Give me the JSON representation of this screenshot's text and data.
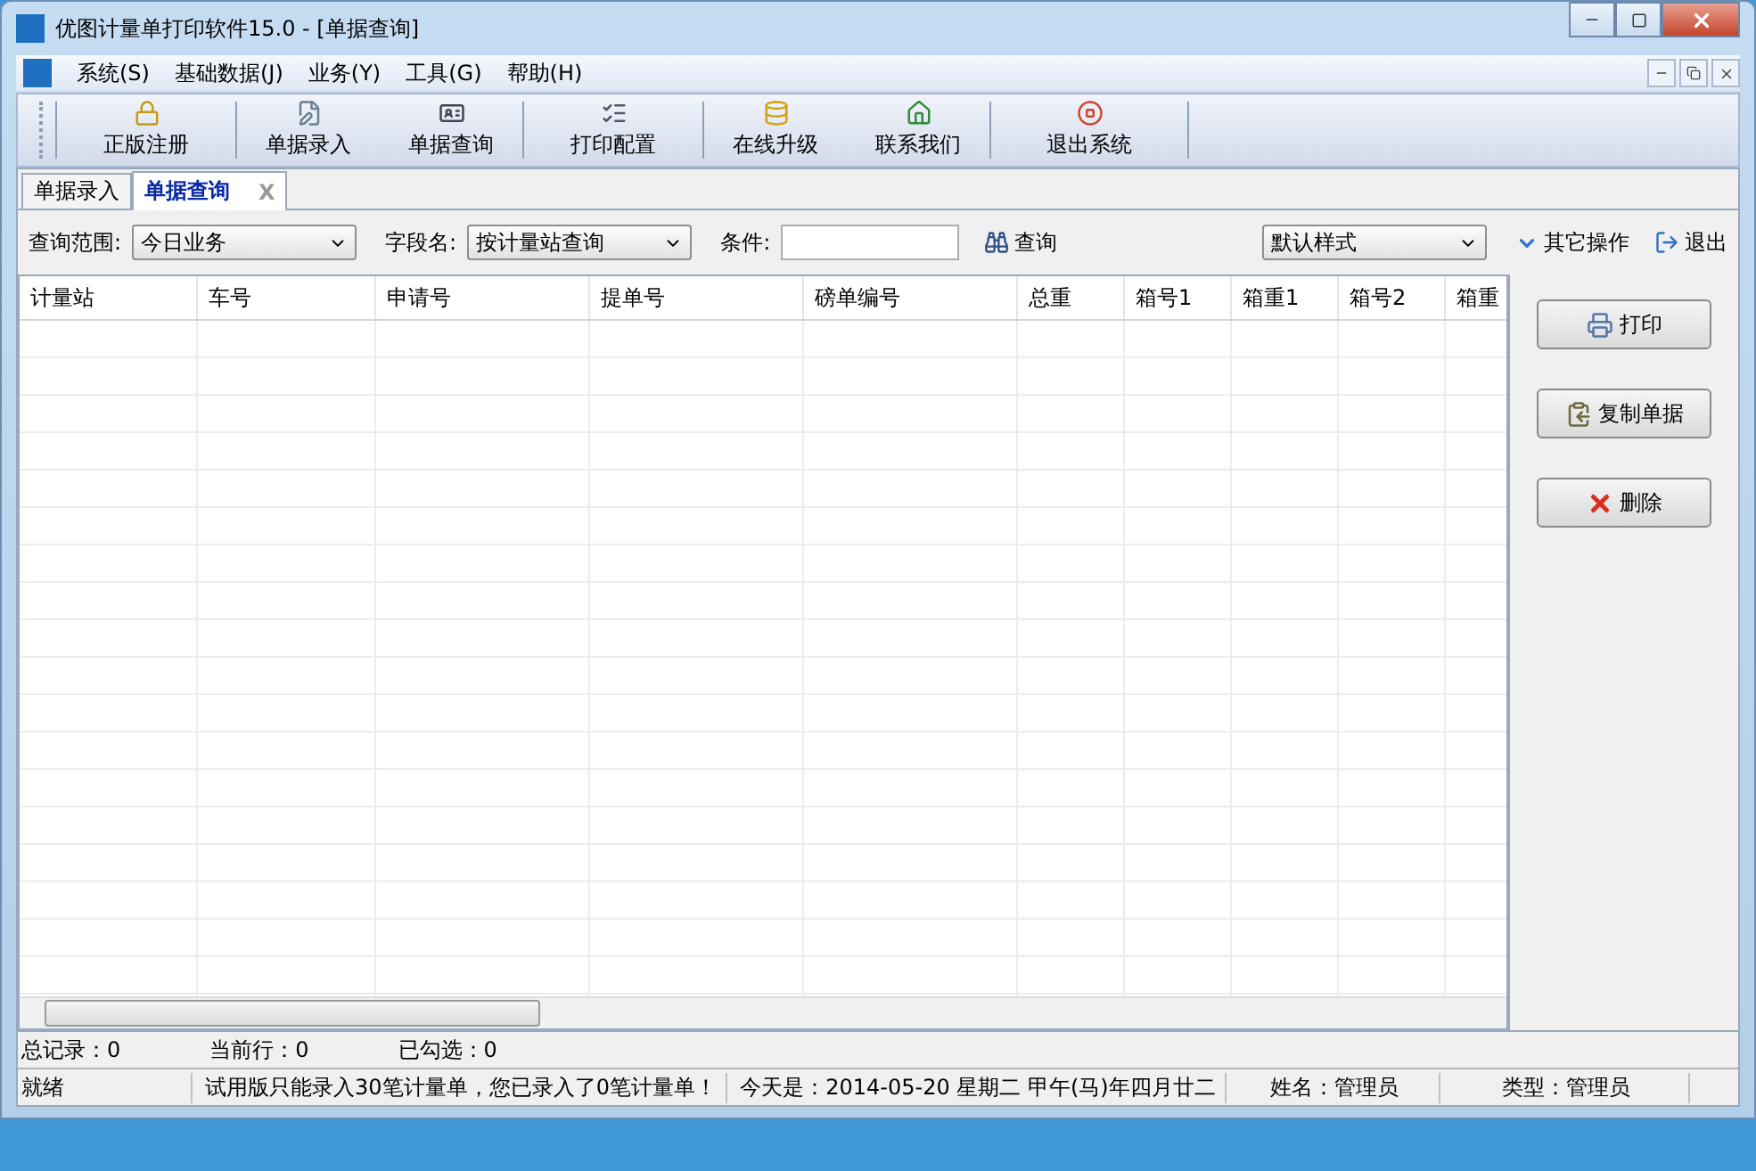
{
  "window": {
    "title": "优图计量单打印软件15.0 - [单据查询]"
  },
  "menu": [
    "系统(S)",
    "基础数据(J)",
    "业务(Y)",
    "工具(G)",
    "帮助(H)"
  ],
  "toolbar": [
    {
      "label": "正版注册",
      "kind": "lock"
    },
    {
      "label": "单据录入",
      "kind": "edit"
    },
    {
      "label": "单据查询",
      "kind": "card"
    },
    {
      "label": "打印配置",
      "kind": "list"
    },
    {
      "label": "在线升级",
      "kind": "db"
    },
    {
      "label": "联系我们",
      "kind": "home"
    },
    {
      "label": "退出系统",
      "kind": "exit"
    }
  ],
  "tabs": [
    {
      "label": "单据录入",
      "selected": false,
      "closable": false
    },
    {
      "label": "单据查询",
      "selected": true,
      "closable": true,
      "close": "X"
    }
  ],
  "query": {
    "range_label": "查询范围:",
    "range_value": "今日业务",
    "field_label": "字段名:",
    "field_value": "按计量站查询",
    "condition_label": "条件:",
    "search_button": "查询",
    "style_value": "默认样式",
    "other_ops": "其它操作",
    "exit": "退出"
  },
  "table": {
    "columns": [
      "计量站",
      "车号",
      "申请号",
      "提单号",
      "磅单编号",
      "总重",
      "箱号1",
      "箱重1",
      "箱号2",
      "箱重"
    ]
  },
  "actions": [
    {
      "label": "打印",
      "kind": "print"
    },
    {
      "label": "复制单据",
      "kind": "copy"
    },
    {
      "label": "删除",
      "kind": "delete"
    }
  ],
  "summary": [
    "总记录：0",
    "当前行：0",
    "已勾选：0"
  ],
  "status_bar": [
    "就绪",
    "试用版只能录入30笔计量单，您已录入了0笔计量单！",
    "今天是：2014-05-20 星期二 甲午(马)年四月廿二",
    "姓名：管理员",
    "类型：管理员"
  ]
}
